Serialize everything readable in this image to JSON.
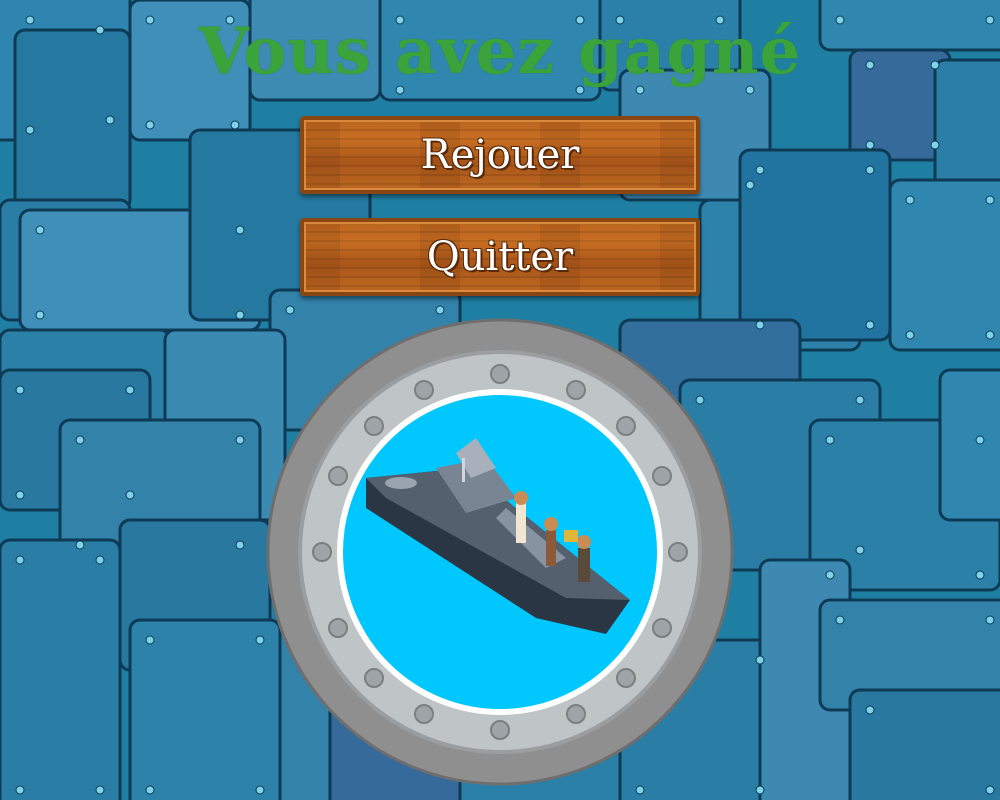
{
  "screen": {
    "title": "Vous avez gagné",
    "title_color": "#3aa43a"
  },
  "menu": {
    "replay_label": "Rejouer",
    "quit_label": "Quitter"
  },
  "colors": {
    "background": "#1f7fa3",
    "plate_light": "#3f8fb8",
    "plate_dark": "#1a6f92",
    "sea": "#00c8ff",
    "wood": "#c06a22"
  },
  "illustration": {
    "frame": "porthole",
    "scene": "ship-with-pirates"
  }
}
